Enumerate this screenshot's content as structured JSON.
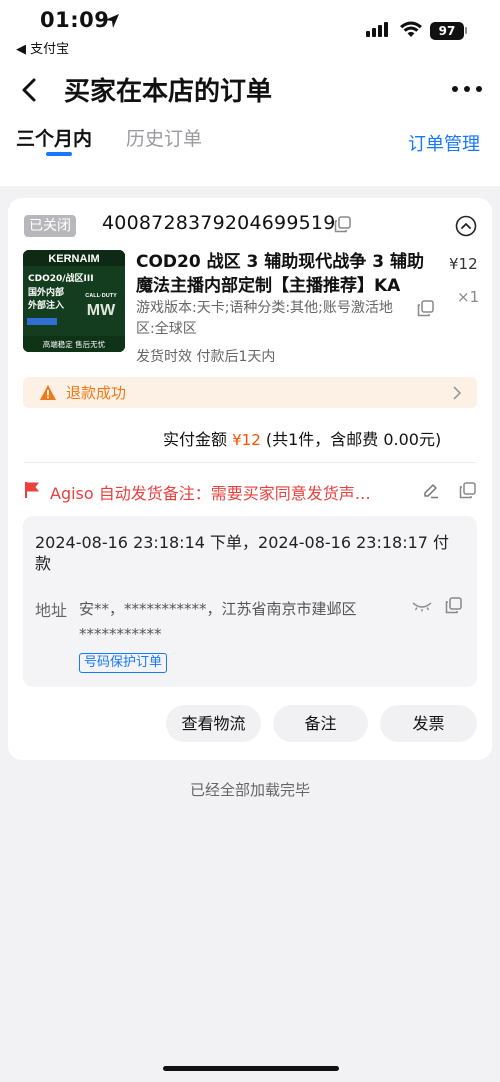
{
  "status_bar": {
    "time": "01:09",
    "back_app": "◀ 支付宝",
    "battery": "97"
  },
  "nav": {
    "title": "买家在本店的订单"
  },
  "tabs": {
    "items": [
      "三个月内",
      "历史订单"
    ],
    "active_index": 0,
    "manage_label": "订单管理"
  },
  "order": {
    "status": "已关闭",
    "order_number": "4008728379204699519",
    "product": {
      "title": "COD20 战区 3 辅助现代战争 3 辅助魔法主播内部定制【主播推荐】KA",
      "price": "¥12",
      "quantity": "×1",
      "spec": "游戏版本:天卡;语种分类:其他;账号激活地区:全球区",
      "ship_time": "发货时效 付款后1天内",
      "image_text": {
        "brand": "KERNAIM",
        "line1": "CDO20/战区III",
        "line2": "国外内部",
        "line3": "外部注入",
        "logo_top": "CALL·DUTY",
        "logo": "MW",
        "footer": "高端稳定 售后无忧"
      }
    },
    "refund": {
      "text": "退款成功"
    },
    "amount": {
      "label": "实付金额",
      "value": "¥12",
      "detail": "(共1件，含邮费 0.00元)"
    },
    "note": {
      "text": "Agiso 自动发货备注：需要买家同意发货声…"
    },
    "info": {
      "times": "2024-08-16 23:18:14 下单，2024-08-16 23:18:17 付款",
      "address_label": "地址",
      "address": "安**，***********，江苏省南京市建邺区 ***********",
      "protect_badge": "号码保护订单"
    },
    "actions": {
      "logistics": "查看物流",
      "remark": "备注",
      "invoice": "发票"
    }
  },
  "footer": {
    "message": "已经全部加载完毕"
  },
  "colors": {
    "accent": "#1677ff",
    "price": "#ff5000",
    "warning": "#ee7a1c",
    "note": "#e8413e"
  },
  "icons": [
    "location-arrow-icon",
    "cellular-signal-icon",
    "wifi-icon",
    "battery-icon",
    "back-arrow-icon",
    "more-dots-icon",
    "copy-icon",
    "collapse-chevron-icon",
    "warning-icon",
    "chevron-right-icon",
    "flag-icon",
    "edit-icon",
    "eye-closed-icon"
  ]
}
